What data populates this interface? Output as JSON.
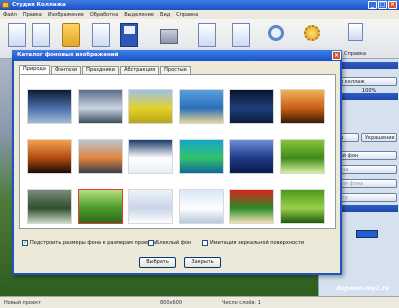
{
  "window": {
    "title": "Студия Коллажа"
  },
  "menu": [
    "Файл",
    "Правка",
    "Изображение",
    "Обработка",
    "Выделение",
    "Вид",
    "Справка"
  ],
  "ribbon": {
    "help_label": "Справка"
  },
  "right_panel": {
    "zoom": "100%",
    "buttons": [
      "стрый коллаж",
      "сфера",
      "Украшение",
      "утовый фон",
      "ля фона",
      "ние для фона",
      "отрастр"
    ]
  },
  "status": {
    "left": "Новый проект",
    "size": "800x600",
    "count": "Число слоёв: 1"
  },
  "watermark": "dopmen.my1.ru",
  "dialog": {
    "title": "Каталог фоновых изображений",
    "tabs": [
      "Природа",
      "Фэнтези",
      "Праздники",
      "Абстракция",
      "Простые"
    ],
    "active_tab": 0,
    "thumbnails": [
      {
        "c1": "#0d1b33",
        "c2": "#4a6fa8",
        "c3": "#9fb8d6"
      },
      {
        "c1": "#5b6d88",
        "c2": "#c9d4e2",
        "c3": "#3d4d5f"
      },
      {
        "c1": "#9cc3ea",
        "c2": "#e3d22a",
        "c3": "#b8a41a"
      },
      {
        "c1": "#5a9fe0",
        "c2": "#2b6fba",
        "c3": "#e6d59a"
      },
      {
        "c1": "#0a1430",
        "c2": "#1f3f7a",
        "c3": "#0c1a3b"
      },
      {
        "c1": "#f0b25a",
        "c2": "#c85f16",
        "c3": "#3b1a08"
      },
      {
        "c1": "#f3a24a",
        "c2": "#b24a12",
        "c3": "#1a0b06"
      },
      {
        "c1": "#b8c4d4",
        "c2": "#e0843c",
        "c3": "#3b3b4a"
      },
      {
        "c1": "#1a3b6a",
        "c2": "#ffffff",
        "c3": "#e8eef6"
      },
      {
        "c1": "#12a8c8",
        "c2": "#33c26a",
        "c3": "#0e6a9a"
      },
      {
        "c1": "#6a8fd6",
        "c2": "#1e3a8a",
        "c3": "#0a1a4a"
      },
      {
        "c1": "#8bc43a",
        "c2": "#3f8a1c",
        "c3": "#d8f0a0"
      },
      {
        "c1": "#7a8a7a",
        "c2": "#2f4f2f",
        "c3": "#c8d8c0"
      },
      {
        "c1": "#b6e07a",
        "c2": "#4a9a2a",
        "c3": "#2f6a1a"
      },
      {
        "c1": "#eef3fa",
        "c2": "#c8d4e6",
        "c3": "#ffffff"
      },
      {
        "c1": "#d8e6f6",
        "c2": "#ffffff",
        "c3": "#b8c8de"
      },
      {
        "c1": "#d8241a",
        "c2": "#2a8a2a",
        "c3": "#f2e2b0"
      },
      {
        "c1": "#4a9a1a",
        "c2": "#9ad04a",
        "c3": "#1e5a0e"
      }
    ],
    "selected_thumb": 13,
    "options": {
      "fit": "Подстроить размеры фона к размерам проекта",
      "fit_checked": "✓",
      "faded": "Блеклый фон",
      "mirror": "Имитация зеркальной поверхности"
    },
    "buttons": {
      "select": "Выбрать",
      "close": "Закрыть"
    }
  }
}
